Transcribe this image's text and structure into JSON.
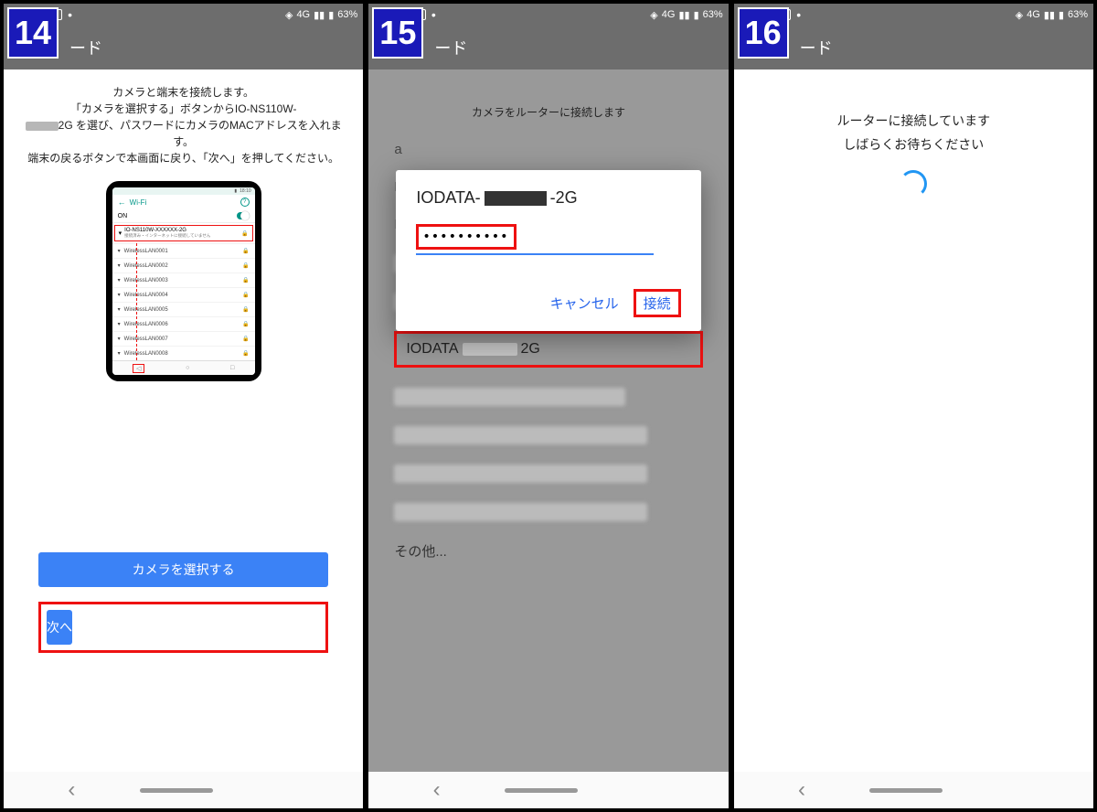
{
  "status_bar": {
    "network_label": "4G",
    "battery": "63%"
  },
  "app_bar_title_suffix": "ード",
  "step14": {
    "badge": "14",
    "instruction_l1": "カメラと端末を接続します。",
    "instruction_l2a": "「カメラを選択する」ボタンからIO-NS110W-",
    "instruction_l2b": "2G を選び、パスワードにカメラのMACアドレスを入れます。",
    "instruction_l3": "端末の戻るボタンで本画面に戻り、「次へ」を押してください。",
    "mock": {
      "wifi_label": "Wi-Fi",
      "on_label": "ON",
      "selected_ssid": "IO-NS110W-XXXXXX-2G",
      "selected_sub": "接続済み・インターネットに接続していません",
      "networks": [
        "WirelessLAN0001",
        "WirelessLAN0002",
        "WirelessLAN0003",
        "WirelessLAN0004",
        "WirelessLAN0005",
        "WirelessLAN0006",
        "WirelessLAN0007",
        "WirelessLAN0008"
      ]
    },
    "btn_select": "カメラを選択する",
    "btn_next": "次へ"
  },
  "step15": {
    "badge": "15",
    "bg_title": "カメラをルーターに接続します",
    "highlighted_prefix": "IODATA",
    "highlighted_suffix": "2G",
    "other_label": "その他...",
    "dialog": {
      "title_prefix": "IODATA-",
      "title_suffix": "-2G",
      "password_mask": "••••••••••••",
      "cancel": "キャンセル",
      "connect": "接続"
    }
  },
  "step16": {
    "badge": "16",
    "line1": "ルーターに接続しています",
    "line2": "しばらくお待ちください"
  }
}
